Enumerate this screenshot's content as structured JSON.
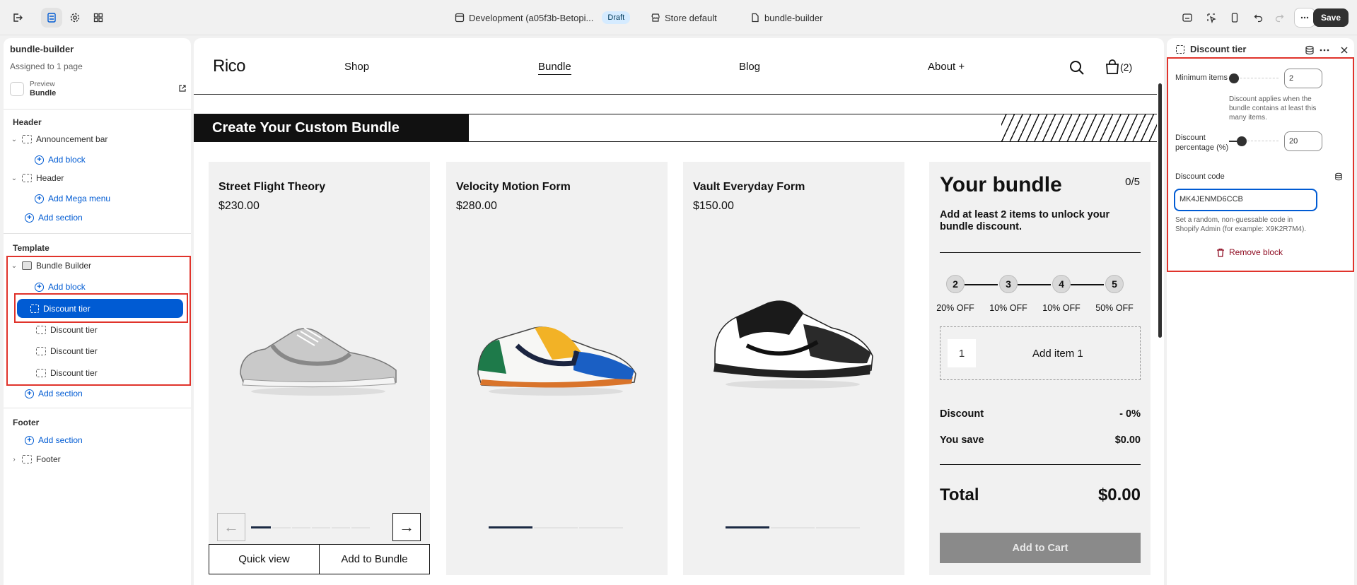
{
  "topbar": {
    "env": "Development (a05f3b-Betopi...",
    "draft": "Draft",
    "store": "Store default",
    "template": "bundle-builder",
    "save": "Save"
  },
  "left": {
    "title": "bundle-builder",
    "assigned": "Assigned to 1 page",
    "preview_label": "Preview",
    "preview_value": "Bundle",
    "header_group": "Header",
    "announcement": "Announcement bar",
    "add_block": "Add block",
    "header": "Header",
    "add_mega": "Add Mega menu",
    "add_section": "Add section",
    "template_group": "Template",
    "bundle_builder": "Bundle Builder",
    "tiers": [
      "Discount tier",
      "Discount tier",
      "Discount tier",
      "Discount tier"
    ],
    "footer_group": "Footer",
    "footer": "Footer"
  },
  "store": {
    "logo": "Rico",
    "nav": [
      "Shop",
      "Bundle",
      "Blog",
      "About +"
    ],
    "cart": "(2)",
    "banner": "Create Your Custom Bundle",
    "products": [
      {
        "name": "Street Flight Theory",
        "price": "$230.00"
      },
      {
        "name": "Velocity Motion Form",
        "price": "$280.00"
      },
      {
        "name": "Vault Everyday Form",
        "price": "$150.00"
      }
    ],
    "quick_view": "Quick view",
    "add_to_bundle": "Add to Bundle",
    "bundle": {
      "title": "Your bundle",
      "count": "0/5",
      "desc": "Add at least 2 items to unlock your bundle discount.",
      "steps": [
        "2",
        "3",
        "4",
        "5"
      ],
      "offs": [
        "20% OFF",
        "10% OFF",
        "10% OFF",
        "50% OFF"
      ],
      "slot_num": "1",
      "slot_label": "Add item 1",
      "discount_label": "Discount",
      "discount_value": "- 0%",
      "save_label": "You save",
      "save_value": "$0.00",
      "total_label": "Total",
      "total_value": "$0.00",
      "add_to_cart": "Add to Cart"
    }
  },
  "right": {
    "title": "Discount tier",
    "min_label": "Minimum items",
    "min_value": "2",
    "min_fraction": 0.0,
    "min_help": "Discount applies when the bundle contains at least this many items.",
    "pct_label_1": "Discount",
    "pct_label_2": "percentage (%)",
    "pct_value": "20",
    "pct_fraction": 0.2,
    "code_label": "Discount code",
    "code_value": "MK4JENMD6CCB",
    "code_help": "Set a random, non-guessable code in Shopify Admin (for example: X9K2R7M4).",
    "remove": "Remove block"
  }
}
